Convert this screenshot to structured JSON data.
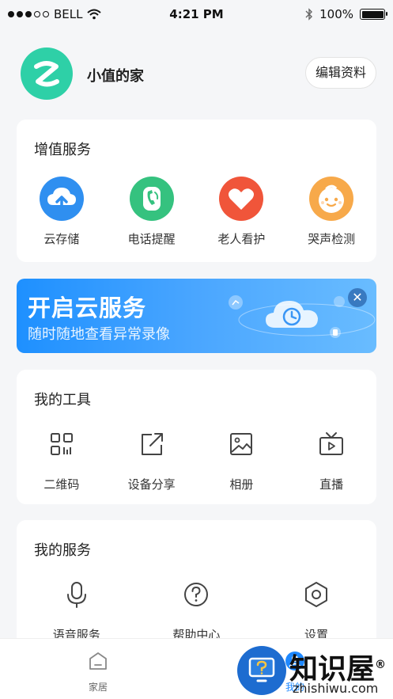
{
  "status_bar": {
    "carrier": "BELL",
    "time": "4:21 PM",
    "battery": "100%",
    "battery_level": 1.0,
    "icons": [
      "signal-dots-icon",
      "wifi-icon",
      "bluetooth-icon",
      "battery-icon"
    ]
  },
  "profile": {
    "name": "小值的家",
    "edit_label": "编辑资料",
    "avatar_color": "#2ed0a7",
    "avatar_letter": "Z"
  },
  "value_services": {
    "title": "增值服务",
    "items": [
      {
        "label": "云存储",
        "icon": "cloud-upload-icon",
        "color": "#2f8ff0"
      },
      {
        "label": "电话提醒",
        "icon": "phone-icon",
        "color": "#35c27f"
      },
      {
        "label": "老人看护",
        "icon": "heart-icon",
        "color": "#f0553a"
      },
      {
        "label": "哭声检测",
        "icon": "baby-face-icon",
        "color": "#f7a94a"
      }
    ]
  },
  "banner": {
    "title": "开启云服务",
    "subtitle": "随时随地查看异常录像",
    "close_icon": "close-icon"
  },
  "my_tools": {
    "title": "我的工具",
    "items": [
      {
        "label": "二维码",
        "icon": "qr-code-icon"
      },
      {
        "label": "设备分享",
        "icon": "share-icon"
      },
      {
        "label": "相册",
        "icon": "photo-album-icon"
      },
      {
        "label": "直播",
        "icon": "live-tv-icon"
      }
    ]
  },
  "my_services": {
    "title": "我的服务",
    "items": [
      {
        "label": "语音服务",
        "icon": "microphone-icon"
      },
      {
        "label": "帮助中心",
        "icon": "help-icon"
      },
      {
        "label": "设置",
        "icon": "settings-icon"
      }
    ]
  },
  "tab_bar": {
    "tabs": [
      {
        "label": "家居",
        "icon": "home-icon",
        "active": false
      },
      {
        "label": "我的",
        "icon": "profile-icon",
        "active": true
      }
    ]
  },
  "watermark": {
    "brand": "知识屋",
    "registered": "®",
    "url": "zhishiwu.com"
  }
}
